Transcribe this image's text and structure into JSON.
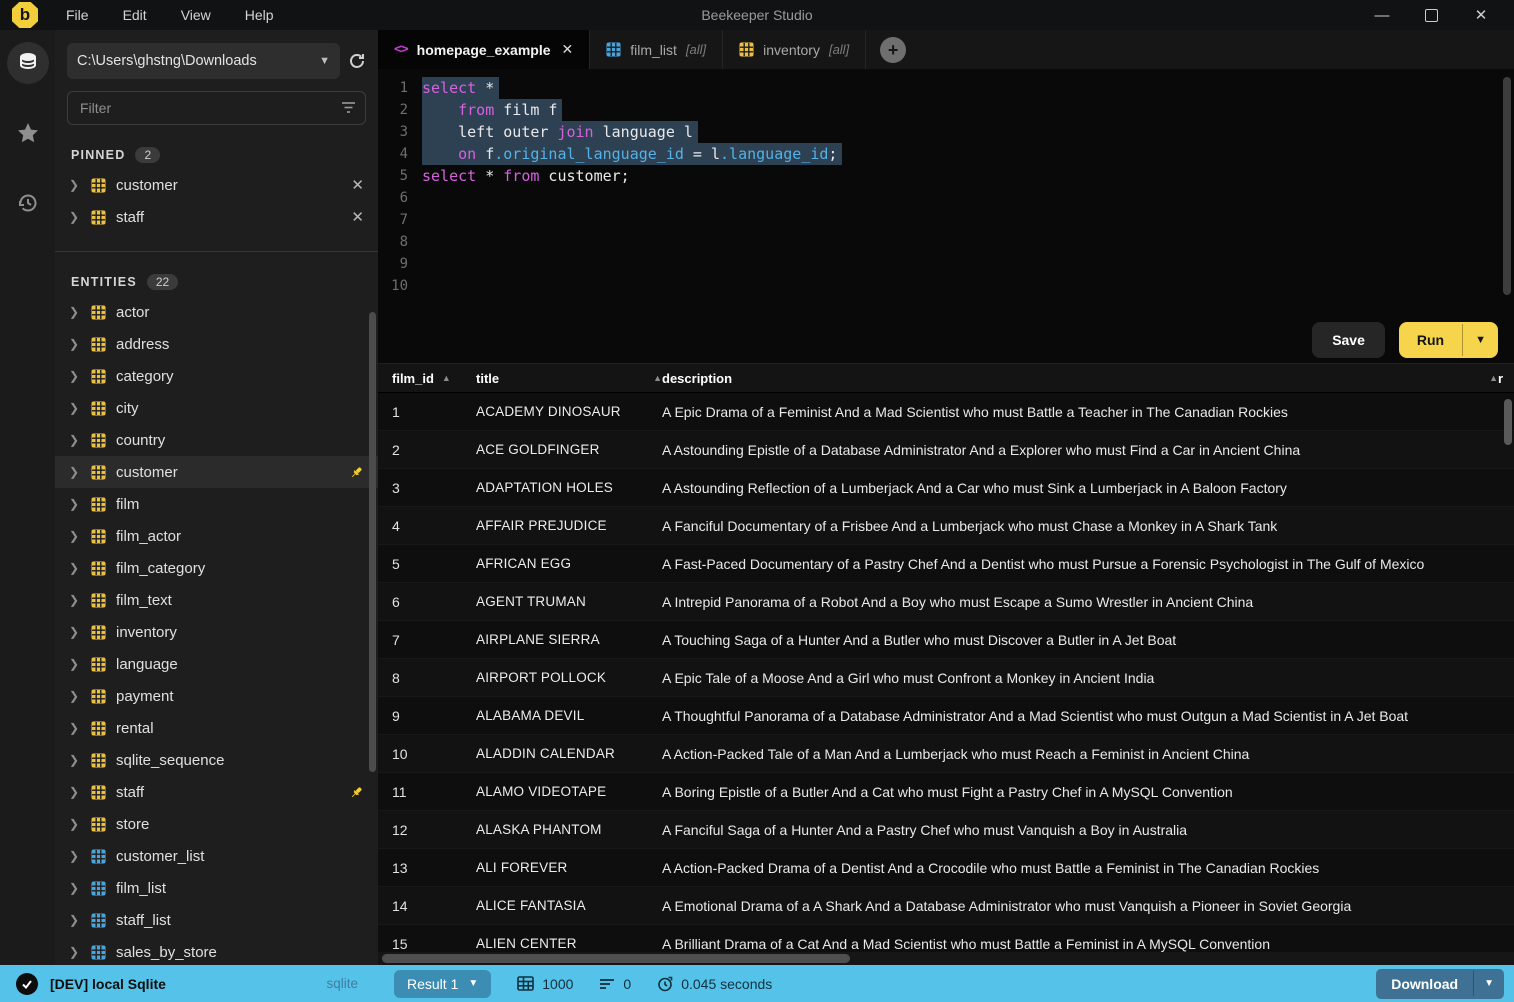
{
  "window": {
    "title": "Beekeeper Studio",
    "menus": [
      "File",
      "Edit",
      "View",
      "Help"
    ],
    "controls": [
      "minimize",
      "maximize",
      "close"
    ]
  },
  "colors": {
    "accent_yellow": "#f2cf3a",
    "run_button": "#f6d44c",
    "status_bar": "#55c3e9",
    "result_button": "#3b8db4",
    "download_button": "#3e7193",
    "keyword_pink": "#d661df",
    "field_blue": "#55b1e6",
    "selection": "#2d4152",
    "table_icon_yellow": "#ecc043",
    "view_icon_blue": "#4ba5dd"
  },
  "sidebar": {
    "connection_path": "C:\\Users\\ghstng\\Downloads",
    "filter_placeholder": "Filter",
    "pinned_label": "PINNED",
    "pinned_count": "2",
    "pinned_items": [
      {
        "name": "customer"
      },
      {
        "name": "staff"
      }
    ],
    "entities_label": "ENTITIES",
    "entities_count": "22",
    "entities": [
      {
        "name": "actor",
        "type": "table"
      },
      {
        "name": "address",
        "type": "table"
      },
      {
        "name": "category",
        "type": "table"
      },
      {
        "name": "city",
        "type": "table"
      },
      {
        "name": "country",
        "type": "table"
      },
      {
        "name": "customer",
        "type": "table",
        "selected": true,
        "pinned": true
      },
      {
        "name": "film",
        "type": "table"
      },
      {
        "name": "film_actor",
        "type": "table"
      },
      {
        "name": "film_category",
        "type": "table"
      },
      {
        "name": "film_text",
        "type": "table"
      },
      {
        "name": "inventory",
        "type": "table"
      },
      {
        "name": "language",
        "type": "table"
      },
      {
        "name": "payment",
        "type": "table"
      },
      {
        "name": "rental",
        "type": "table"
      },
      {
        "name": "sqlite_sequence",
        "type": "table"
      },
      {
        "name": "staff",
        "type": "table",
        "pinned": true
      },
      {
        "name": "store",
        "type": "table"
      },
      {
        "name": "customer_list",
        "type": "view"
      },
      {
        "name": "film_list",
        "type": "view"
      },
      {
        "name": "staff_list",
        "type": "view"
      },
      {
        "name": "sales_by_store",
        "type": "view"
      }
    ]
  },
  "tabs": [
    {
      "label": "homepage_example",
      "suffix": "",
      "icon": "code",
      "active": true,
      "closable": true
    },
    {
      "label": "film_list",
      "suffix": "[all]",
      "icon": "table-view",
      "active": false,
      "closable": false
    },
    {
      "label": "inventory",
      "suffix": "[all]",
      "icon": "table",
      "active": false,
      "closable": false
    }
  ],
  "editor": {
    "lines": [
      {
        "sel": true,
        "tokens": [
          {
            "c": "kw",
            "t": "select"
          },
          {
            "c": "pl",
            "t": " *"
          }
        ]
      },
      {
        "sel": true,
        "tokens": [
          {
            "c": "pl",
            "t": "    "
          },
          {
            "c": "kw",
            "t": "from"
          },
          {
            "c": "pl",
            "t": " film f"
          }
        ]
      },
      {
        "sel": true,
        "tokens": [
          {
            "c": "pl",
            "t": "    left outer "
          },
          {
            "c": "kw",
            "t": "join"
          },
          {
            "c": "pl",
            "t": " language l"
          }
        ]
      },
      {
        "sel": true,
        "tokens": [
          {
            "c": "pl",
            "t": "    "
          },
          {
            "c": "kw",
            "t": "on"
          },
          {
            "c": "pl",
            "t": " f"
          },
          {
            "c": "fd",
            "t": ".original_language_id"
          },
          {
            "c": "pl",
            "t": " = l"
          },
          {
            "c": "fd",
            "t": ".language_id"
          },
          {
            "c": "pl",
            "t": ";"
          }
        ]
      },
      {
        "sel": false,
        "tokens": [
          {
            "c": "kw",
            "t": "select"
          },
          {
            "c": "pl",
            "t": " * "
          },
          {
            "c": "kw",
            "t": "from"
          },
          {
            "c": "pl",
            "t": " customer;"
          }
        ]
      },
      {
        "sel": false,
        "tokens": []
      },
      {
        "sel": false,
        "tokens": []
      },
      {
        "sel": false,
        "tokens": []
      },
      {
        "sel": false,
        "tokens": []
      },
      {
        "sel": false,
        "tokens": []
      }
    ]
  },
  "actions": {
    "save_label": "Save",
    "run_label": "Run"
  },
  "results_table": {
    "columns": [
      "film_id",
      "title",
      "description"
    ],
    "partial_next_column": "r",
    "rows": [
      [
        "1",
        "ACADEMY DINOSAUR",
        "A Epic Drama of a Feminist And a Mad Scientist who must Battle a Teacher in The Canadian Rockies"
      ],
      [
        "2",
        "ACE GOLDFINGER",
        "A Astounding Epistle of a Database Administrator And a Explorer who must Find a Car in Ancient China"
      ],
      [
        "3",
        "ADAPTATION HOLES",
        "A Astounding Reflection of a Lumberjack And a Car who must Sink a Lumberjack in A Baloon Factory"
      ],
      [
        "4",
        "AFFAIR PREJUDICE",
        "A Fanciful Documentary of a Frisbee And a Lumberjack who must Chase a Monkey in A Shark Tank"
      ],
      [
        "5",
        "AFRICAN EGG",
        "A Fast-Paced Documentary of a Pastry Chef And a Dentist who must Pursue a Forensic Psychologist in The Gulf of Mexico"
      ],
      [
        "6",
        "AGENT TRUMAN",
        "A Intrepid Panorama of a Robot And a Boy who must Escape a Sumo Wrestler in Ancient China"
      ],
      [
        "7",
        "AIRPLANE SIERRA",
        "A Touching Saga of a Hunter And a Butler who must Discover a Butler in A Jet Boat"
      ],
      [
        "8",
        "AIRPORT POLLOCK",
        "A Epic Tale of a Moose And a Girl who must Confront a Monkey in Ancient India"
      ],
      [
        "9",
        "ALABAMA DEVIL",
        "A Thoughtful Panorama of a Database Administrator And a Mad Scientist who must Outgun a Mad Scientist in A Jet Boat"
      ],
      [
        "10",
        "ALADDIN CALENDAR",
        "A Action-Packed Tale of a Man And a Lumberjack who must Reach a Feminist in Ancient China"
      ],
      [
        "11",
        "ALAMO VIDEOTAPE",
        "A Boring Epistle of a Butler And a Cat who must Fight a Pastry Chef in A MySQL Convention"
      ],
      [
        "12",
        "ALASKA PHANTOM",
        "A Fanciful Saga of a Hunter And a Pastry Chef who must Vanquish a Boy in Australia"
      ],
      [
        "13",
        "ALI FOREVER",
        "A Action-Packed Drama of a Dentist And a Crocodile who must Battle a Feminist in The Canadian Rockies"
      ],
      [
        "14",
        "ALICE FANTASIA",
        "A Emotional Drama of a A Shark And a Database Administrator who must Vanquish a Pioneer in Soviet Georgia"
      ],
      [
        "15",
        "ALIEN CENTER",
        "A Brilliant Drama of a Cat And a Mad Scientist who must Battle a Feminist in A MySQL Convention"
      ]
    ]
  },
  "status_bar": {
    "connection_name": "[DEV] local Sqlite",
    "db_type": "sqlite",
    "result_selector": "Result 1",
    "record_count": "1000",
    "affected_count": "0",
    "duration": "0.045 seconds",
    "download_label": "Download"
  }
}
